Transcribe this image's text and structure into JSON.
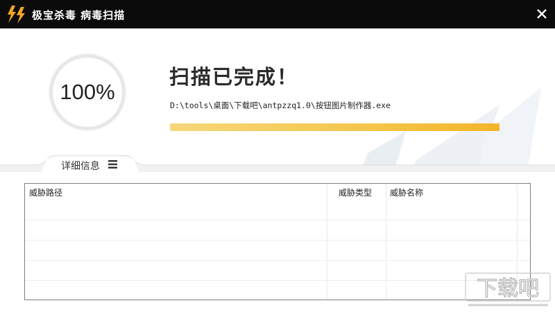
{
  "window": {
    "title": "极宝杀毒  病毒扫描",
    "close_icon": "close-icon",
    "logo_icon": "lightning-logo-icon",
    "accent": "#f5c54a"
  },
  "scan": {
    "percent_text": "100%",
    "progress": 1.0,
    "headline": "扫描已完成！",
    "current_file": "D:\\tools\\桌面\\下载吧\\antpzzq1.0\\按钮图片制作器.exe"
  },
  "details_tab": {
    "label": "详细信息",
    "menu_icon": "menu-icon"
  },
  "threat_table": {
    "columns": [
      "威胁路径",
      "威胁类型",
      "威胁名称"
    ],
    "rows": []
  },
  "watermark": {
    "text": "下载吧"
  }
}
